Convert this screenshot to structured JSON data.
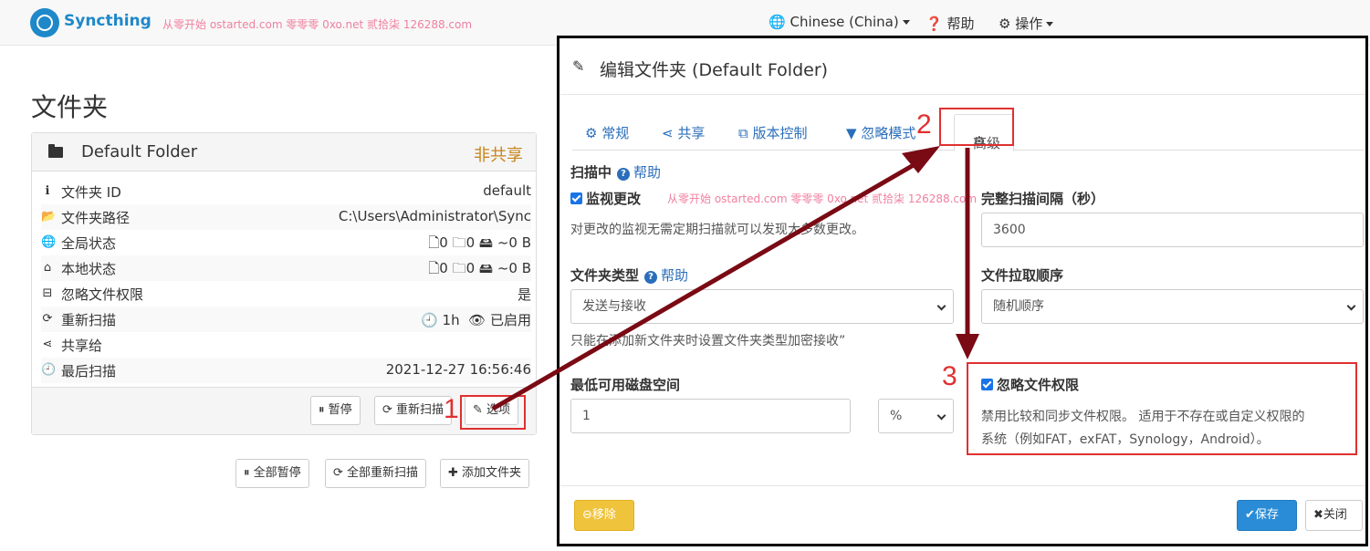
{
  "navbar": {
    "brand": "Syncthing",
    "watermark": "从零开始 ostarted.com 零零零 0xo.net 贰拾柒 126288.com",
    "language": "Chinese (China)",
    "help": "帮助",
    "actions": "操作"
  },
  "page": {
    "title": "文件夹"
  },
  "folder_panel": {
    "name": "Default Folder",
    "status": "非共享",
    "rows": [
      {
        "icon": "info-icon",
        "label": "文件夹 ID",
        "value": "default"
      },
      {
        "icon": "folder-open-icon",
        "label": "文件夹路径",
        "value": "C:\\Users\\Administrator\\Sync"
      },
      {
        "icon": "globe-icon",
        "label": "全局状态",
        "value": "🗋0  🗀0  🖴 ~0 B"
      },
      {
        "icon": "home-icon",
        "label": "本地状态",
        "value": "🗋0  🗀0  🖴 ~0 B"
      },
      {
        "icon": "minus-square-icon",
        "label": "忽略文件权限",
        "value": "是"
      },
      {
        "icon": "refresh-icon",
        "label": "重新扫描",
        "value": "1h",
        "value2": "已启用"
      },
      {
        "icon": "share-icon",
        "label": "共享给",
        "value": ""
      },
      {
        "icon": "clock-icon",
        "label": "最后扫描",
        "value": "2021-12-27 16:56:46"
      }
    ],
    "buttons": {
      "pause": "暂停",
      "rescan": "重新扫描",
      "options": "选项"
    }
  },
  "global_buttons": {
    "pause_all": "全部暂停",
    "rescan_all": "全部重新扫描",
    "add_folder": "添加文件夹"
  },
  "modal": {
    "title": "编辑文件夹 (Default Folder)",
    "tabs": {
      "general": "常规",
      "sharing": "共享",
      "versioning": "版本控制",
      "ignore": "忽略模式",
      "advanced": "高级"
    },
    "scanning": {
      "label": "扫描中",
      "help": "帮助"
    },
    "watch": {
      "label": "监视更改",
      "watermark": "从零开始 ostarted.com 零零零 0xo.net 贰拾柒 126288.com",
      "desc": "对更改的监视无需定期扫描就可以发现大多数更改。"
    },
    "full_rescan": {
      "label": "完整扫描间隔（秒）",
      "value": "3600"
    },
    "folder_type": {
      "label": "文件夹类型",
      "help": "帮助",
      "value": "发送与接收",
      "note": "只能在添加新文件夹时设置文件夹类型加密接收”"
    },
    "pull_order": {
      "label": "文件拉取顺序",
      "value": "随机顺序"
    },
    "min_disk": {
      "label": "最低可用磁盘空间",
      "value": "1",
      "unit": "%"
    },
    "ignore_perms": {
      "label": "忽略文件权限",
      "desc1": "禁用比较和同步文件权限。 适用于不存在或自定义权限的",
      "desc2": "系统（例如FAT，exFAT，Synology，Android）。"
    },
    "footer": {
      "remove": "移除",
      "save": "保存",
      "close": "关闭"
    }
  },
  "annotations": {
    "n1": "1",
    "n2": "2",
    "n3": "3"
  },
  "colors": {
    "arrow": "#7a0a14",
    "highlight": "#e03030",
    "accent": "#2a6ebb",
    "warning": "#f0c33c",
    "primary": "#2a8cd6"
  }
}
